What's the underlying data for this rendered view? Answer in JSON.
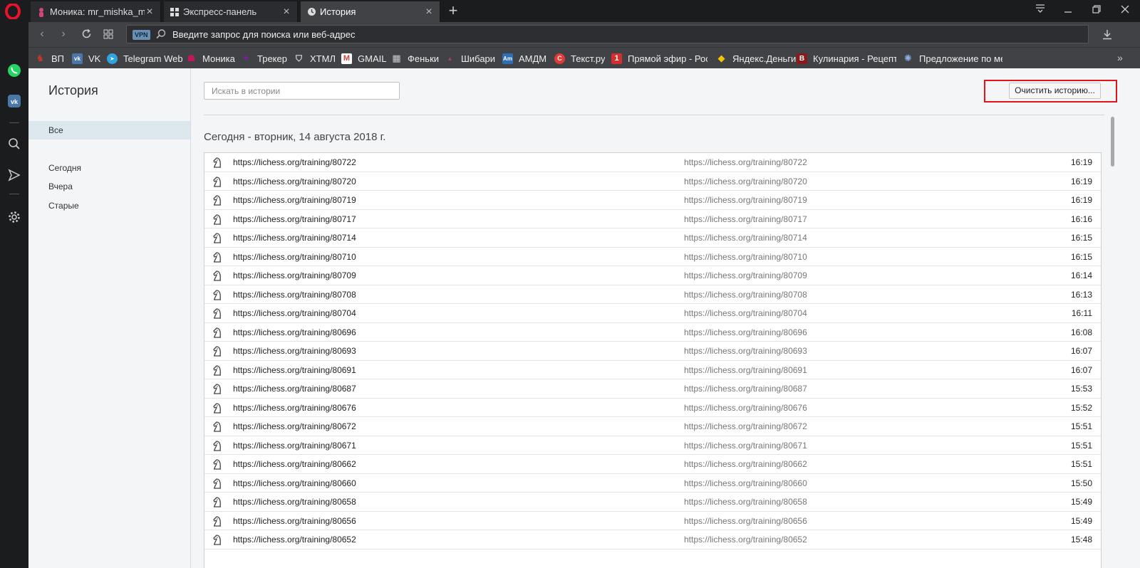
{
  "tabs": [
    {
      "title": "Моника: mr_mishka_mail",
      "icon": "monica-icon",
      "active": false
    },
    {
      "title": "Экспресс-панель",
      "icon": "grid-icon",
      "active": false
    },
    {
      "title": "История",
      "icon": "clock-icon",
      "active": true
    }
  ],
  "address": {
    "vpn": "VPN",
    "text": "Введите запрос для поиска или веб-адрес"
  },
  "bookmarks": [
    {
      "label": "ВП",
      "icon": "vp-icon",
      "color": "#c0392b"
    },
    {
      "label": "VK",
      "icon": "vk-icon",
      "color": "#4a76a8"
    },
    {
      "label": "Telegram Web",
      "icon": "telegram-icon",
      "color": "#2ca5e0"
    },
    {
      "label": "Моника",
      "icon": "monica-icon",
      "color": "#c2185b"
    },
    {
      "label": "Трекер",
      "icon": "tracker-icon",
      "color": "#7b1fa2"
    },
    {
      "label": "ХТМЛ",
      "icon": "html-shield-icon",
      "color": "#555555"
    },
    {
      "label": "GMAIL",
      "icon": "gmail-icon",
      "color": "#d44638"
    },
    {
      "label": "Феньки",
      "icon": "pattern-icon",
      "color": "#888888"
    },
    {
      "label": "Шибари",
      "icon": "shibari-icon",
      "color": "#b04080"
    },
    {
      "label": "АМДМ",
      "icon": "amdm-icon",
      "color": "#2f6db5"
    },
    {
      "label": "Текст.ру",
      "icon": "textru-icon",
      "color": "#e53935"
    },
    {
      "label": "Прямой эфир - Росс",
      "icon": "channel-one-icon",
      "color": "#d32f2f"
    },
    {
      "label": "Яндекс.Деньги",
      "icon": "yandex-money-icon",
      "color": "#f5c400"
    },
    {
      "label": "Кулинария - Рецепт",
      "icon": "cooking-icon",
      "color": "#8b1a1a"
    },
    {
      "label": "Предложение по ме",
      "icon": "proposal-icon",
      "color": "#3b5998"
    }
  ],
  "page": {
    "title": "История",
    "nav": {
      "all": "Все",
      "today": "Сегодня",
      "yesterday": "Вчера",
      "older": "Старые"
    },
    "search_placeholder": "Искать в истории",
    "clear_button": "Очистить историю...",
    "date_heading": "Сегодня - вторник, 14 августа 2018 г."
  },
  "history": [
    {
      "title": "https://lichess.org/training/80722",
      "url": "https://lichess.org/training/80722",
      "time": "16:19"
    },
    {
      "title": "https://lichess.org/training/80720",
      "url": "https://lichess.org/training/80720",
      "time": "16:19"
    },
    {
      "title": "https://lichess.org/training/80719",
      "url": "https://lichess.org/training/80719",
      "time": "16:19"
    },
    {
      "title": "https://lichess.org/training/80717",
      "url": "https://lichess.org/training/80717",
      "time": "16:16"
    },
    {
      "title": "https://lichess.org/training/80714",
      "url": "https://lichess.org/training/80714",
      "time": "16:15"
    },
    {
      "title": "https://lichess.org/training/80710",
      "url": "https://lichess.org/training/80710",
      "time": "16:15"
    },
    {
      "title": "https://lichess.org/training/80709",
      "url": "https://lichess.org/training/80709",
      "time": "16:14"
    },
    {
      "title": "https://lichess.org/training/80708",
      "url": "https://lichess.org/training/80708",
      "time": "16:13"
    },
    {
      "title": "https://lichess.org/training/80704",
      "url": "https://lichess.org/training/80704",
      "time": "16:11"
    },
    {
      "title": "https://lichess.org/training/80696",
      "url": "https://lichess.org/training/80696",
      "time": "16:08"
    },
    {
      "title": "https://lichess.org/training/80693",
      "url": "https://lichess.org/training/80693",
      "time": "16:07"
    },
    {
      "title": "https://lichess.org/training/80691",
      "url": "https://lichess.org/training/80691",
      "time": "16:07"
    },
    {
      "title": "https://lichess.org/training/80687",
      "url": "https://lichess.org/training/80687",
      "time": "15:53"
    },
    {
      "title": "https://lichess.org/training/80676",
      "url": "https://lichess.org/training/80676",
      "time": "15:52"
    },
    {
      "title": "https://lichess.org/training/80672",
      "url": "https://lichess.org/training/80672",
      "time": "15:51"
    },
    {
      "title": "https://lichess.org/training/80671",
      "url": "https://lichess.org/training/80671",
      "time": "15:51"
    },
    {
      "title": "https://lichess.org/training/80662",
      "url": "https://lichess.org/training/80662",
      "time": "15:51"
    },
    {
      "title": "https://lichess.org/training/80660",
      "url": "https://lichess.org/training/80660",
      "time": "15:50"
    },
    {
      "title": "https://lichess.org/training/80658",
      "url": "https://lichess.org/training/80658",
      "time": "15:49"
    },
    {
      "title": "https://lichess.org/training/80656",
      "url": "https://lichess.org/training/80656",
      "time": "15:49"
    },
    {
      "title": "https://lichess.org/training/80652",
      "url": "https://lichess.org/training/80652",
      "time": "15:48"
    }
  ]
}
